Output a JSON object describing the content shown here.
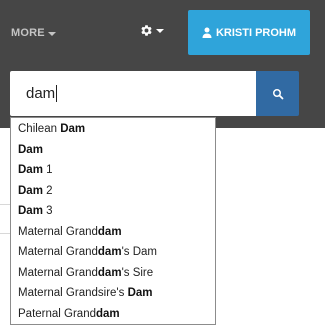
{
  "header": {
    "more_label": "MORE",
    "user_button_label": "KRISTI PROHM"
  },
  "search": {
    "query": "dam"
  },
  "suggestions": [
    {
      "pre": "Chilean ",
      "match": "Dam",
      "post": ""
    },
    {
      "pre": "",
      "match": "Dam",
      "post": ""
    },
    {
      "pre": "",
      "match": "Dam",
      "post": " 1"
    },
    {
      "pre": "",
      "match": "Dam",
      "post": " 2"
    },
    {
      "pre": "",
      "match": "Dam",
      "post": " 3"
    },
    {
      "pre": "Maternal Grand",
      "match": "dam",
      "post": ""
    },
    {
      "pre": "Maternal Grand",
      "match": "dam",
      "post": "'s Dam"
    },
    {
      "pre": "Maternal Grand",
      "match": "dam",
      "post": "'s Sire"
    },
    {
      "pre": "Maternal Grandsire's ",
      "match": "Dam",
      "post": ""
    },
    {
      "pre": "Paternal Grand",
      "match": "dam",
      "post": ""
    }
  ],
  "colors": {
    "topbar": "#464646",
    "user_button": "#2fa4da",
    "search_button": "#316aa3"
  },
  "icons": {
    "settings": "gear-icon",
    "user": "user-icon",
    "search": "search-icon"
  }
}
